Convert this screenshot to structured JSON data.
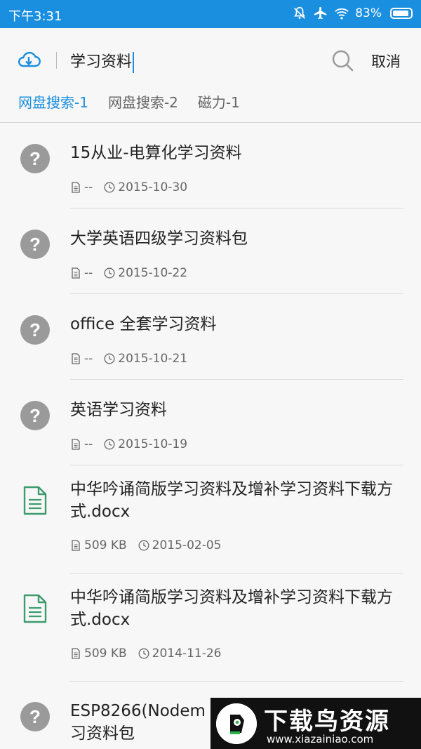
{
  "status_bar": {
    "time": "下午3:31",
    "battery": "83%",
    "icons": [
      "mute-icon",
      "airplane-icon",
      "wifi-icon",
      "battery-icon"
    ]
  },
  "search": {
    "query": "学习资料",
    "cancel_label": "取消"
  },
  "tabs": [
    {
      "label": "网盘搜索-1",
      "active": true
    },
    {
      "label": "网盘搜索-2",
      "active": false
    },
    {
      "label": "磁力-1",
      "active": false
    }
  ],
  "results": [
    {
      "icon": "unknown-file-icon",
      "title": "15从业-电算化学习资料",
      "size": "--",
      "date": "2015-10-30"
    },
    {
      "icon": "unknown-file-icon",
      "title": "大学英语四级学习资料包",
      "size": "--",
      "date": "2015-10-22"
    },
    {
      "icon": "unknown-file-icon",
      "title": "office 全套学习资料",
      "size": "--",
      "date": "2015-10-21"
    },
    {
      "icon": "unknown-file-icon",
      "title": "英语学习资料",
      "size": "--",
      "date": "2015-10-19"
    },
    {
      "icon": "document-icon",
      "title": "中华吟诵简版学习资料及增补学习资料下载方式.docx",
      "size": "509 KB",
      "date": "2015-02-05"
    },
    {
      "icon": "document-icon",
      "title": "中华吟诵简版学习资料及增补学习资料下载方式.docx",
      "size": "509 KB",
      "date": "2014-11-26"
    },
    {
      "icon": "unknown-file-icon",
      "title": "ESP8266(Nodem",
      "title_line2": "习资料包"
    }
  ],
  "watermark": {
    "title": "下载鸟资源",
    "url": "www.xiazainiao.com"
  },
  "colors": {
    "accent": "#1a8fe0",
    "unknown_icon": "#9a9a9a",
    "document_icon": "#3d9b6e"
  }
}
